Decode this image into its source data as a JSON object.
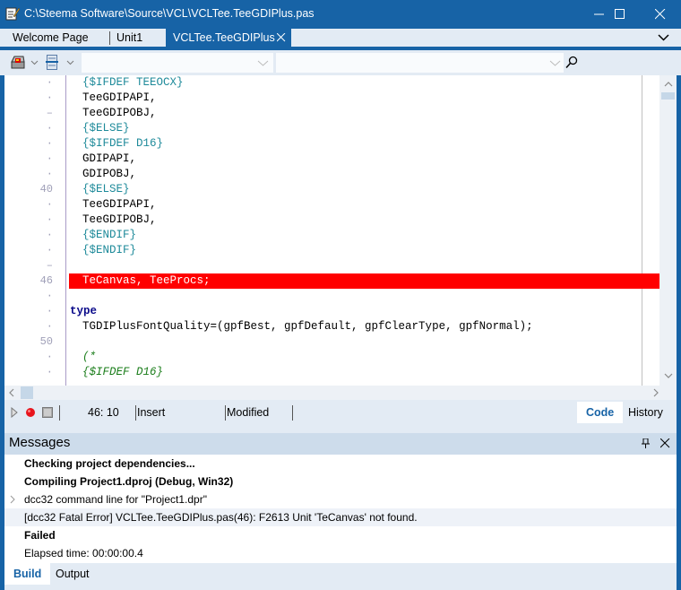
{
  "window": {
    "title": "C:\\Steema Software\\Source\\VCL\\VCLTee.TeeGDIPlus.pas",
    "controls": {
      "minimize_icon": "minimize-icon",
      "maximize_icon": "maximize-icon",
      "close_icon": "close-icon"
    }
  },
  "tabs": [
    {
      "label": "Welcome Page",
      "active": false
    },
    {
      "label": "Unit1",
      "active": false
    },
    {
      "label": "VCLTee.TeeGDIPlus",
      "active": true
    }
  ],
  "toolbar": {
    "combo1_value": "",
    "combo2_value": ""
  },
  "editor": {
    "lines": [
      {
        "num": "·",
        "code": "{$IFDEF TEEOCX}",
        "style": "dir"
      },
      {
        "num": "·",
        "code": "TeeGDIPAPI,",
        "style": "plain"
      },
      {
        "num": "–",
        "code": "TeeGDIPOBJ,",
        "style": "plain"
      },
      {
        "num": "·",
        "code": "{$ELSE}",
        "style": "dir"
      },
      {
        "num": "·",
        "code": "{$IFDEF D16}",
        "style": "dir"
      },
      {
        "num": "·",
        "code": "GDIPAPI,",
        "style": "plain"
      },
      {
        "num": "·",
        "code": "GDIPOBJ,",
        "style": "plain"
      },
      {
        "num": "40",
        "code": "{$ELSE}",
        "style": "dir"
      },
      {
        "num": "·",
        "code": "TeeGDIPAPI,",
        "style": "plain"
      },
      {
        "num": "·",
        "code": "TeeGDIPOBJ,",
        "style": "plain"
      },
      {
        "num": "·",
        "code": "{$ENDIF}",
        "style": "dir"
      },
      {
        "num": "·",
        "code": "{$ENDIF}",
        "style": "dir"
      },
      {
        "num": "–",
        "code": "",
        "style": "plain"
      },
      {
        "num": "46",
        "code": "TeCanvas, TeeProcs;",
        "style": "error"
      },
      {
        "num": "·",
        "code": "",
        "style": "plain"
      },
      {
        "num": "·",
        "code": "type",
        "style": "kw"
      },
      {
        "num": "·",
        "code": "TGDIPlusFontQuality=(gpfBest, gpfDefault, gpfClearType, gpfNormal);",
        "style": "plain"
      },
      {
        "num": "50",
        "code": "",
        "style": "plain"
      },
      {
        "num": "·",
        "code": "(*",
        "style": "comment"
      },
      {
        "num": "·",
        "code": "{$IFDEF D16}",
        "style": "comment"
      }
    ]
  },
  "statusbar": {
    "position": "46: 10",
    "mode": "Insert",
    "state": "Modified",
    "views": [
      {
        "label": "Code",
        "active": true
      },
      {
        "label": "History",
        "active": false
      }
    ]
  },
  "messages": {
    "title": "Messages",
    "rows": [
      {
        "text": "Checking project dependencies...",
        "bold": true,
        "expandable": false,
        "highlight": false
      },
      {
        "text": "Compiling Project1.dproj (Debug, Win32)",
        "bold": true,
        "expandable": false,
        "highlight": false
      },
      {
        "text": "dcc32 command line for \"Project1.dpr\"",
        "bold": false,
        "expandable": true,
        "highlight": false
      },
      {
        "text": "[dcc32 Fatal Error] VCLTee.TeeGDIPlus.pas(46): F2613 Unit 'TeCanvas' not found.",
        "bold": false,
        "expandable": false,
        "highlight": true
      },
      {
        "text": "Failed",
        "bold": true,
        "expandable": false,
        "highlight": false
      },
      {
        "text": "Elapsed time: 00:00:00.4",
        "bold": false,
        "expandable": false,
        "highlight": false
      }
    ],
    "tabs": [
      {
        "label": "Build",
        "active": true
      },
      {
        "label": "Output",
        "active": false
      }
    ]
  },
  "colors": {
    "accent": "#1763a6",
    "error_line": "#ff0000",
    "directive": "#1e8a9a",
    "comment": "#1a7d1a",
    "keyword": "#0a0a8a"
  }
}
